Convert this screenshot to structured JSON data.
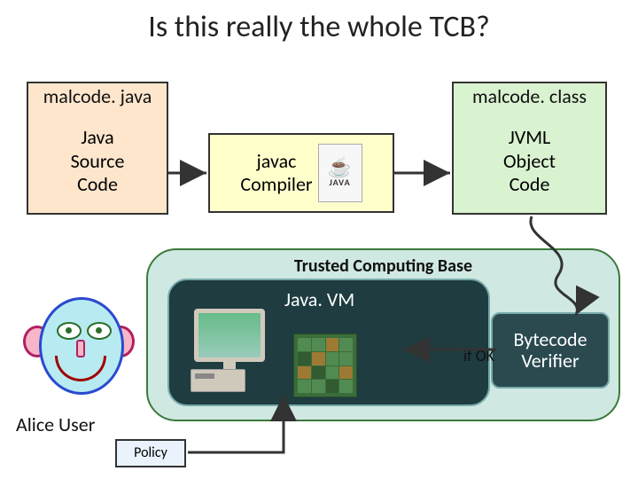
{
  "title": "Is this really the whole TCB?",
  "source_box": {
    "tab": "malcode. java",
    "body": "Java\nSource\nCode"
  },
  "compiler_box": {
    "label": "javac\nCompiler",
    "logo_text": "JAVA"
  },
  "object_box": {
    "tab": "malcode. class",
    "body": "JVML\nObject\nCode"
  },
  "tcb": {
    "label": "Trusted Computing Base",
    "javavm": "Java. VM",
    "verifier": "Bytecode\nVerifier",
    "ifok": "if OK"
  },
  "alice": "Alice User",
  "policy": "Policy"
}
